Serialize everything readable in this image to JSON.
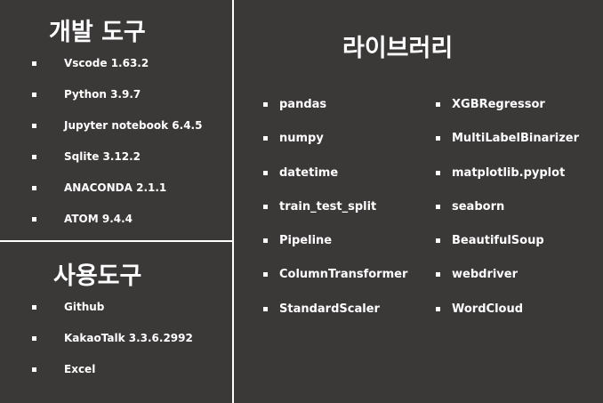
{
  "dev_tools": {
    "title": "개발 도구",
    "items": [
      "Vscode 1.63.2",
      "Python 3.9.7",
      "Jupyter notebook 6.4.5",
      "Sqlite 3.12.2",
      "ANACONDA 2.1.1",
      "ATOM 9.4.4"
    ]
  },
  "use_tools": {
    "title": "사용도구",
    "items": [
      "Github",
      "KakaoTalk 3.3.6.2992",
      "Excel"
    ]
  },
  "libraries": {
    "title": "라이브러리",
    "col1": [
      "pandas",
      "numpy",
      "datetime",
      "train_test_split",
      "Pipeline",
      "ColumnTransformer",
      "StandardScaler"
    ],
    "col2": [
      "XGBRegressor",
      "MultiLabelBinarizer",
      "matplotlib.pyplot",
      "seaborn",
      "BeautifulSoup",
      "webdriver",
      "WordCloud"
    ]
  },
  "colors": {
    "background": "#3b3838",
    "text": "#ffffff"
  }
}
